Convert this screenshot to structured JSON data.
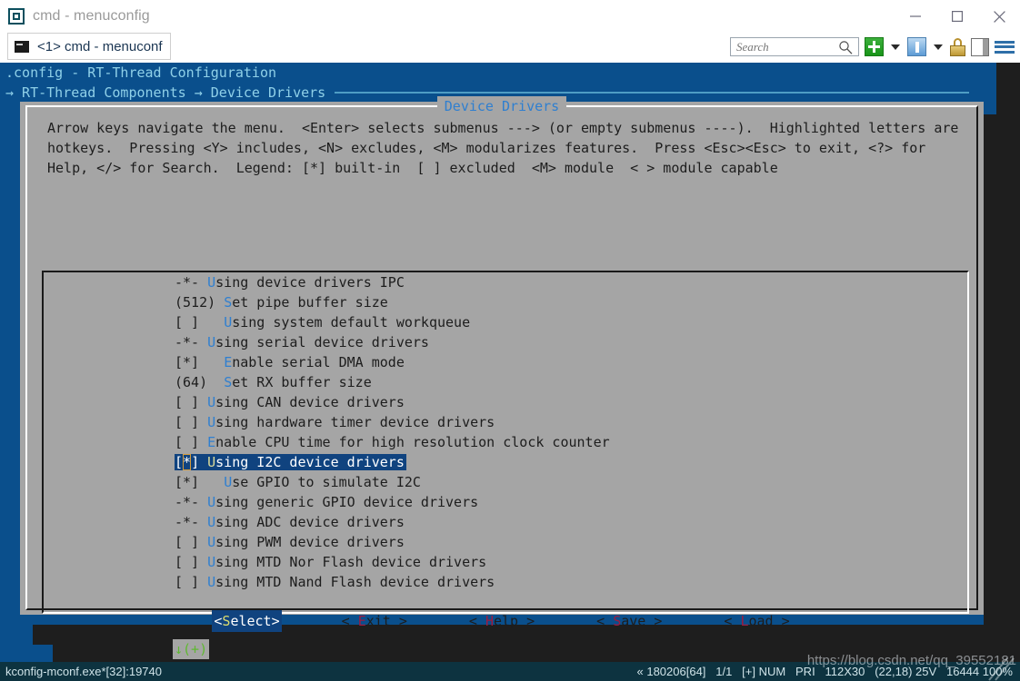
{
  "window": {
    "title": "cmd - menuconfig",
    "icon": "console-window-icon",
    "minimize_label": "—",
    "maximize_label": "□",
    "close_label": "✕"
  },
  "tabs": [
    {
      "label": "<1> cmd - menuconf",
      "icon": "console-icon",
      "active": true
    }
  ],
  "toolbar": {
    "search_placeholder": "Search",
    "search_value": "",
    "items": [
      {
        "name": "new-tab-button",
        "icon": "green-plus-icon"
      },
      {
        "name": "new-tab-dropdown",
        "icon": "chevron-down-icon"
      },
      {
        "name": "info-button",
        "icon": "blue-info-icon"
      },
      {
        "name": "info-dropdown",
        "icon": "chevron-down-icon"
      },
      {
        "name": "lock-button",
        "icon": "lock-icon"
      },
      {
        "name": "layout-button",
        "icon": "split-panel-icon"
      },
      {
        "name": "menu-button",
        "icon": "hamburger-menu-icon"
      }
    ]
  },
  "terminal": {
    "header_line1": ".config - RT-Thread Configuration",
    "header_line2": "→ RT-Thread Components → Device Drivers",
    "colors": {
      "background": "#0a4f8c",
      "header_text": "#8fd0e8",
      "dialog_bg": "#a5a5a5",
      "highlight_bg": "#10437f",
      "hotkey_blue": "#2f7fd0",
      "hotkey_red": "#9e1b3f",
      "scroll_green": "#5fb832",
      "cursor_orange": "#d39a3a"
    }
  },
  "dialog": {
    "title": "Device Drivers",
    "help_text": "Arrow keys navigate the menu.  <Enter> selects submenus ---> (or empty submenus ----).  Highlighted letters are hotkeys.  Pressing <Y> includes, <N> excludes, <M> modularizes features.  Press <Esc><Esc> to exit, <?> for Help, </> for Search.  Legend: [*] built-in  [ ] excluded  <M> module  < > module capable",
    "scroll_marker": "↓(+)",
    "items": [
      {
        "marker": "-*- ",
        "hot": "U",
        "rest": "sing device drivers IPC",
        "selected": false
      },
      {
        "marker": "(512) ",
        "hot": "S",
        "rest": "et pipe buffer size",
        "selected": false
      },
      {
        "marker": "[ ]   ",
        "hot": "U",
        "rest": "sing system default workqueue",
        "selected": false
      },
      {
        "marker": "-*- ",
        "hot": "U",
        "rest": "sing serial device drivers",
        "selected": false
      },
      {
        "marker": "[*]   ",
        "hot": "E",
        "rest": "nable serial DMA mode",
        "selected": false
      },
      {
        "marker": "(64)  ",
        "hot": "S",
        "rest": "et RX buffer size",
        "selected": false
      },
      {
        "marker": "[ ] ",
        "hot": "U",
        "rest": "sing CAN device drivers",
        "selected": false
      },
      {
        "marker": "[ ] ",
        "hot": "U",
        "rest": "sing hardware timer device drivers",
        "selected": false
      },
      {
        "marker": "[ ] ",
        "hot": "E",
        "rest": "nable CPU time for high resolution clock counter",
        "selected": false
      },
      {
        "marker": "[*] ",
        "hot": "U",
        "rest": "sing I2C device drivers",
        "selected": true
      },
      {
        "marker": "[*]   ",
        "hot": "U",
        "rest": "se GPIO to simulate I2C",
        "selected": false
      },
      {
        "marker": "-*- ",
        "hot": "U",
        "rest": "sing generic GPIO device drivers",
        "selected": false
      },
      {
        "marker": "-*- ",
        "hot": "U",
        "rest": "sing ADC device drivers",
        "selected": false
      },
      {
        "marker": "[ ] ",
        "hot": "U",
        "rest": "sing PWM device drivers",
        "selected": false
      },
      {
        "marker": "[ ] ",
        "hot": "U",
        "rest": "sing MTD Nor Flash device drivers",
        "selected": false
      },
      {
        "marker": "[ ] ",
        "hot": "U",
        "rest": "sing MTD Nand Flash device drivers",
        "selected": false
      }
    ],
    "buttons": [
      {
        "pre": "<",
        "hot": "S",
        "post": "elect>",
        "selected": true,
        "name": "select-button"
      },
      {
        "pre": "< ",
        "hot": "E",
        "post": "xit >",
        "selected": false,
        "name": "exit-button"
      },
      {
        "pre": "< ",
        "hot": "H",
        "post": "elp >",
        "selected": false,
        "name": "help-button"
      },
      {
        "pre": "< ",
        "hot": "S",
        "post": "ave >",
        "selected": false,
        "name": "save-button"
      },
      {
        "pre": "< ",
        "hot": "L",
        "post": "oad >",
        "selected": false,
        "name": "load-button"
      }
    ]
  },
  "statusbar": {
    "left": "kconfig-mconf.exe*[32]:19740",
    "right": "« 180206[64]   1/1   [+] NUM   PRI   112X30   (22,18) 25V   16444 100%"
  },
  "watermark": "https://blog.csdn.net/qq_39552181"
}
